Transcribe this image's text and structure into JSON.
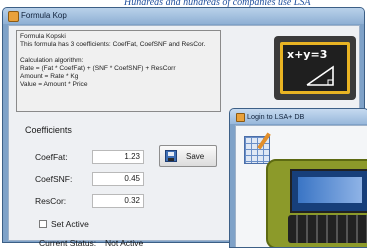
{
  "header_text": "Hundreds and hundreds of companies use LSA",
  "window": {
    "title": "Formula Kop"
  },
  "description": {
    "lines": [
      "Formula Kopski",
      "This formula has 3 coefficients: CoefFat, CoefSNF and ResCor.",
      "",
      "Calculation algorithm:",
      "Rate = (Fat * CoefFat) + (SNF * CoefSNF) + ResCorr",
      "Amount = Rate * Kg",
      "Value = Amount * Price"
    ]
  },
  "formula_image": {
    "equation": "x+y=3",
    "icon": "math-board-icon"
  },
  "coefficients": {
    "title": "Coefficients",
    "fields": [
      {
        "label": "CoefFat:",
        "value": "1.23"
      },
      {
        "label": "CoefSNF:",
        "value": "0.45"
      },
      {
        "label": "ResCor:",
        "value": "0.32"
      }
    ]
  },
  "set_active": {
    "label": "Set Active",
    "checked": false
  },
  "save_button": {
    "label": "Save",
    "icon": "disk-icon"
  },
  "status": {
    "label": "Current Status:",
    "value": "Not Active"
  },
  "login_window": {
    "title": "Login to LSA+ DB",
    "icon": "sheet-icon"
  },
  "colors": {
    "window_frame": "#7fa2c8",
    "accent": "#e8b323"
  }
}
